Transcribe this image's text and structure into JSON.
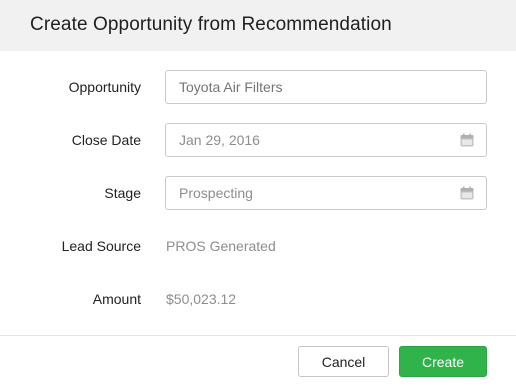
{
  "dialog": {
    "title": "Create Opportunity from Recommendation"
  },
  "form": {
    "opportunity": {
      "label": "Opportunity",
      "placeholder": "Toyota Air Filters",
      "value": ""
    },
    "close_date": {
      "label": "Close Date",
      "value": "Jan 29, 2016",
      "icon": "calendar-icon"
    },
    "stage": {
      "label": "Stage",
      "value": "Prospecting",
      "icon": "calendar-icon"
    },
    "lead_source": {
      "label": "Lead Source",
      "value": "PROS Generated"
    },
    "amount": {
      "label": "Amount",
      "value": "$50,023.12"
    }
  },
  "footer": {
    "cancel_label": "Cancel",
    "create_label": "Create"
  },
  "colors": {
    "header_bg": "#f1f1f1",
    "primary": "#2fb34a",
    "border": "#c9c9c9",
    "muted_text": "#8e8e8e"
  }
}
